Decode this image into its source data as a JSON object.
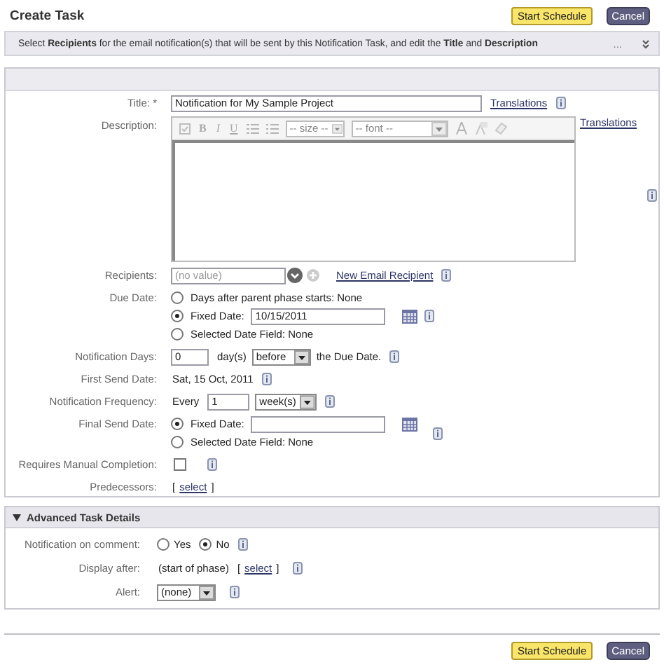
{
  "header": {
    "title": "Create Task",
    "buttons": [
      {
        "label": "Start Schedule",
        "kind": "primary"
      },
      {
        "label": "Cancel",
        "kind": "secondary"
      }
    ]
  },
  "info_bar": {
    "text": "Select **Recipients** for the email notification(s) that will be sent by this Notification Task, and edit the **Title** and **Description**",
    "more": "...",
    "collapsed": true
  },
  "task_form": {
    "fields": [
      {
        "kind": "text",
        "label": "Title:",
        "required_mark": "*",
        "value": "Notification for My Sample Project",
        "link": "Translations",
        "info": true
      },
      {
        "kind": "editor",
        "label": "Description:",
        "link": "Translations",
        "info": true,
        "toolbar": {
          "disabled": true,
          "format_buttons": [
            "B",
            "I",
            "U"
          ],
          "size_select": "-- size --",
          "font_select": "-- font --"
        }
      },
      {
        "kind": "recipients",
        "label": "Recipients:",
        "placeholder": "(no value)",
        "link": "New Email Recipient",
        "info": true
      },
      {
        "kind": "radios",
        "label": "Due Date:",
        "info": true,
        "options": [
          {
            "label": "Days after parent phase starts: None",
            "selected": false
          },
          {
            "label": "Fixed Date:",
            "selected": true,
            "value": "10/15/2011",
            "calendar": true
          },
          {
            "label": "Selected Date Field: None",
            "selected": false
          }
        ]
      },
      {
        "kind": "days",
        "label": "Notification Days:",
        "value": "0",
        "unit": "day(s)",
        "select": "before",
        "suffix": "the Due Date.",
        "info": true
      },
      {
        "kind": "static",
        "label": "First Send Date:",
        "text": "Sat, 15 Oct, 2011",
        "info": true
      },
      {
        "kind": "frequency",
        "label": "Notification Frequency:",
        "prefix": "Every",
        "value": "1",
        "select": "week(s)",
        "info": true
      },
      {
        "kind": "radios",
        "label": "Final Send Date:",
        "info": true,
        "options": [
          {
            "label": "Fixed Date:",
            "selected": true,
            "calendar": true
          },
          {
            "label": "Selected Date Field: None",
            "selected": false
          }
        ]
      },
      {
        "kind": "checkbox",
        "label": "Requires Manual Completion:",
        "checked": false,
        "info": true
      },
      {
        "kind": "link",
        "label": "Predecessors:",
        "open": "[",
        "link": "select",
        "close": "]",
        "info": false
      }
    ]
  },
  "advanced": {
    "title": "Advanced Task Details",
    "expanded": true,
    "fields": [
      {
        "kind": "inline_radios",
        "label": "Notification on comment:",
        "info": true,
        "options": [
          {
            "label": "Yes",
            "selected": false
          },
          {
            "label": "No",
            "selected": true
          }
        ]
      },
      {
        "kind": "link",
        "label": "Display after:",
        "text": "(start of phase)",
        "open": "[",
        "link": "select",
        "close": "]",
        "info": true
      },
      {
        "kind": "select",
        "label": "Alert:",
        "select": "(none)",
        "info": true
      }
    ]
  },
  "footer": {
    "buttons": [
      {
        "label": "Start Schedule",
        "kind": "primary"
      },
      {
        "label": "Cancel",
        "kind": "secondary"
      }
    ]
  }
}
